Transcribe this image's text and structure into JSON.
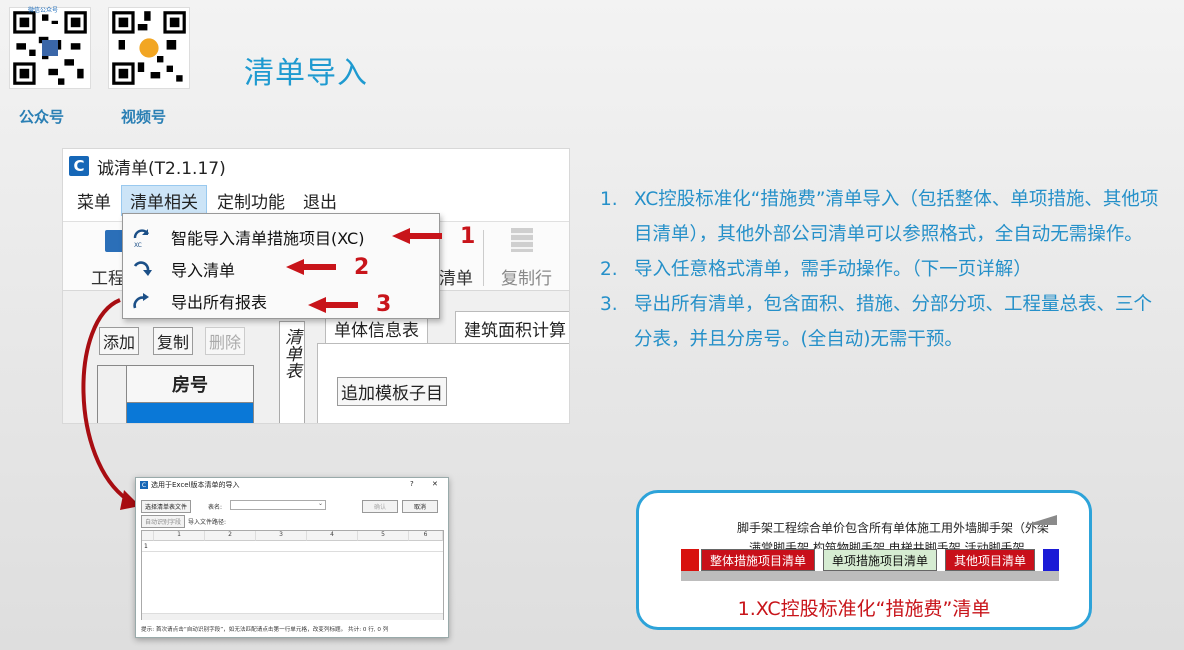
{
  "slide": {
    "title": "清单导入",
    "qr": [
      {
        "caption_top": "微信公众号",
        "label": "公众号"
      },
      {
        "label": "视频号"
      }
    ]
  },
  "app": {
    "logo": "C",
    "title": "诚清单(T2.1.17)",
    "menus": [
      "菜单",
      "清单相关",
      "定制功能",
      "退出"
    ],
    "toolbar": {
      "left_text": "工程",
      "right_text": "清单",
      "copy_row": "复制行"
    },
    "buttons": {
      "add": "添加",
      "copy": "复制",
      "delete": "删除"
    },
    "grid_header": "房号",
    "vertical_tab": "清单表",
    "tabs": [
      "单体信息表",
      "建筑面积计算"
    ],
    "add_template": "追加模板子目",
    "dropdown": [
      {
        "label": "智能导入清单措施项目(XC)",
        "number": "1",
        "icon": "import-xc-icon"
      },
      {
        "label": "导入清单",
        "number": "2",
        "icon": "import-icon"
      },
      {
        "label": "导出所有报表",
        "number": "3",
        "icon": "export-icon"
      }
    ]
  },
  "dialog": {
    "logo": "C",
    "title": "选用于Excel版本清单的导入",
    "help": "?",
    "close": "✕",
    "select_file": "选择清单表文件",
    "sheet_label": "表名:",
    "confirm": "确认",
    "cancel": "取消",
    "auto_recognize": "自动识别字段",
    "path_label": "导入文件路径:",
    "columns": [
      "1",
      "2",
      "3",
      "4",
      "5",
      "6"
    ],
    "row1": "1",
    "hint": "提示: 首次请点击“自动识别字段”，如无法匹配请点击第一行单元格，改变列标题。 共计: 0 行, 0 列"
  },
  "points": [
    {
      "num": "1.",
      "text": "XC控股标准化“措施费”清单导入（包括整体、单项措施、其他项目清单），其他外部公司清单可以参照格式，全自动无需操作。"
    },
    {
      "num": "2.",
      "text": "导入任意格式清单，需手动操作。（下一页详解）"
    },
    {
      "num": "3.",
      "text": "导出所有清单，包含面积、措施、分部分项、工程量总表、三个分表，并且分房号。(全自动)无需干预。"
    }
  ],
  "callout": {
    "line1": "脚手架工程综合单价包含所有单体施工用外墙脚手架（外架",
    "line2": "满堂脚手架  构筑物脚手架  电梯井脚手架  活动脚手架",
    "tabs": [
      "整体措施项目清单",
      "单项措施项目清单",
      "其他项目清单"
    ],
    "caption": "1.XC控股标准化“措施费”清单"
  },
  "colors": {
    "accent": "#2590c9",
    "title": "#1e9ad0",
    "red": "#c8141a",
    "callout_border": "#2da3d9"
  }
}
